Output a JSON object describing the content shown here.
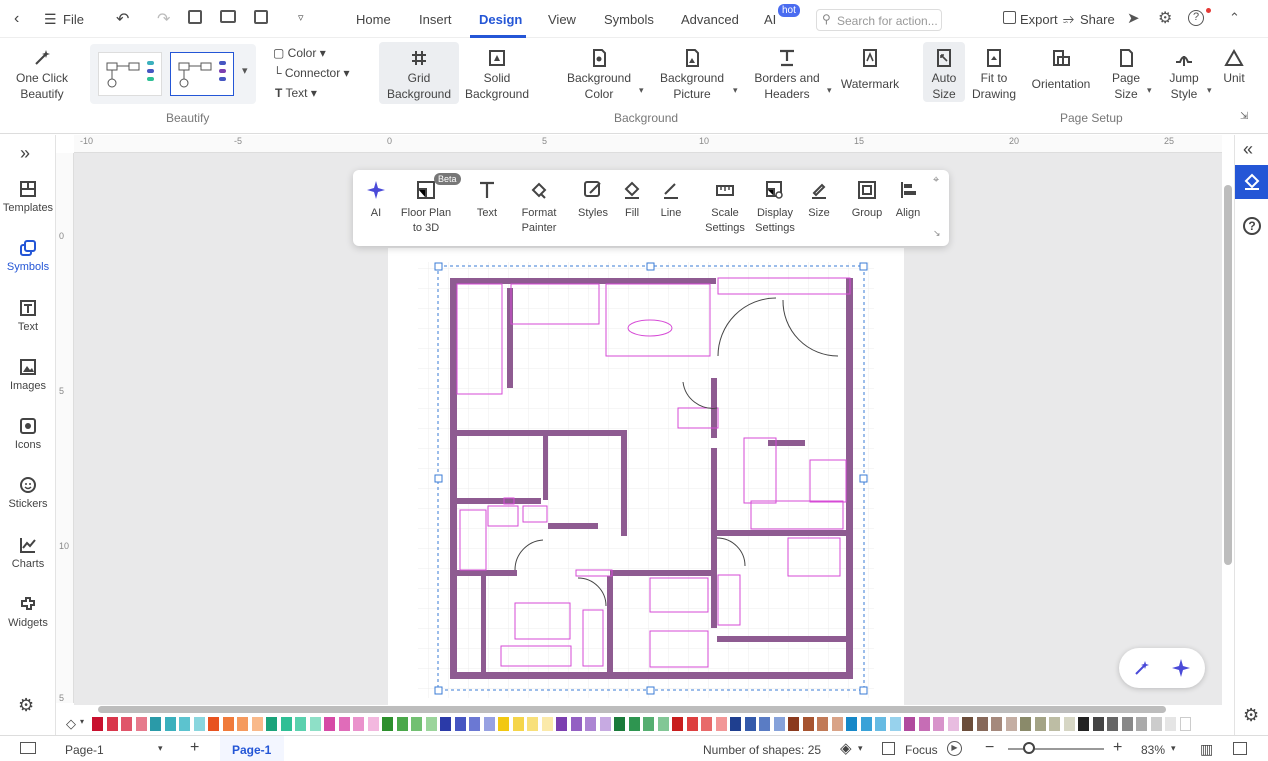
{
  "topbar": {
    "file_label": "File",
    "tabs": [
      "Home",
      "Insert",
      "Design",
      "View",
      "Symbols",
      "Advanced",
      "AI"
    ],
    "hot_badge": "hot",
    "search_placeholder": "Search for action...",
    "export_label": "Export",
    "share_label": "Share"
  },
  "ribbon": {
    "one_click_beautify": "One Click Beautify",
    "color_label": "Color",
    "connector_label": "Connector",
    "text_label": "Text",
    "grid_background": "Grid Background",
    "solid_background": "Solid Background",
    "background_color": "Background Color",
    "background_picture": "Background Picture",
    "borders_headers": "Borders and Headers",
    "watermark": "Watermark",
    "auto_size": "Auto Size",
    "fit_to_drawing": "Fit to Drawing",
    "orientation": "Orientation",
    "page_size": "Page Size",
    "jump_style": "Jump Style",
    "unit": "Unit",
    "group_beautify": "Beautify",
    "group_background": "Background",
    "group_page_setup": "Page Setup"
  },
  "leftbar": {
    "items": [
      "Templates",
      "Symbols",
      "Text",
      "Images",
      "Icons",
      "Stickers",
      "Charts",
      "Widgets"
    ]
  },
  "ruler": {
    "h_ticks": [
      "-10",
      "-5",
      "0",
      "5",
      "10",
      "15",
      "20",
      "25"
    ],
    "v_ticks": [
      "0",
      "5",
      "10",
      "5"
    ]
  },
  "floating_toolbar": {
    "ai": "AI",
    "floor_plan": "Floor Plan to 3D",
    "beta": "Beta",
    "text": "Text",
    "format_painter": "Format Painter",
    "styles": "Styles",
    "fill": "Fill",
    "line": "Line",
    "scale_settings": "Scale Settings",
    "display_settings": "Display Settings",
    "size": "Size",
    "group": "Group",
    "align": "Align"
  },
  "statusbar": {
    "page_dropdown": "Page-1",
    "page_tab": "Page-1",
    "shapes_count": "Number of shapes: 25",
    "focus": "Focus",
    "zoom": "83%"
  },
  "colors": {
    "accent": "#2456d6",
    "wall": "#8e5b91",
    "select": "#d64ad6"
  },
  "palette": [
    "#c8102e",
    "#d9364b",
    "#e0556a",
    "#e67a8c",
    "#2a9aa8",
    "#3bb0bd",
    "#5cc3cf",
    "#89d6de",
    "#e8531f",
    "#f07a3a",
    "#f59a5e",
    "#f9b98a",
    "#1ba37a",
    "#2fbf95",
    "#5ad1ae",
    "#8ee0c7",
    "#d64aa6",
    "#e06cb9",
    "#ea92cc",
    "#f3b8df",
    "#2c8f2c",
    "#4aa84a",
    "#72c072",
    "#9bd59b",
    "#2b3aa8",
    "#4656c2",
    "#6b78d3",
    "#97a1e2",
    "#f2c811",
    "#f5d54a",
    "#f8e07a",
    "#fbeaaa",
    "#7b3fb0",
    "#9360c3",
    "#ac85d3",
    "#c7aae2",
    "#1a7a3a",
    "#2e9550",
    "#55ae70",
    "#82c796",
    "#c81d1d",
    "#dd3f3f",
    "#e86a6a",
    "#f29797",
    "#1f3f8f",
    "#345aab",
    "#5a7cc4",
    "#86a2da",
    "#8b3a1e",
    "#a6532f",
    "#c17a57",
    "#d9a387",
    "#1688c8",
    "#3aa2d8",
    "#67bbe3",
    "#97d2ed",
    "#b04a9e",
    "#c66db5",
    "#d894cb",
    "#e8bce0",
    "#6b4d3a",
    "#87695a",
    "#a5897c",
    "#c4aea3",
    "#8a8a6a",
    "#a3a385",
    "#bdbda4",
    "#d6d6c4",
    "#222222",
    "#444444",
    "#666666",
    "#888888",
    "#aaaaaa",
    "#cccccc",
    "#e5e5e5",
    "#ffffff"
  ]
}
